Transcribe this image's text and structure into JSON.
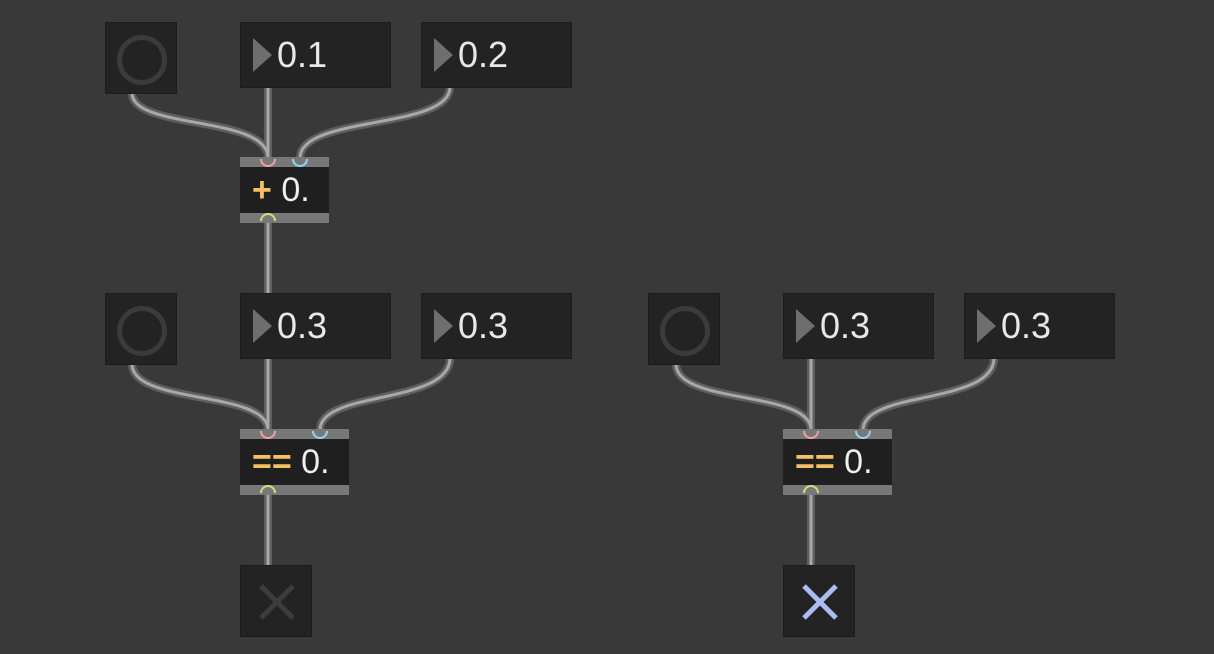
{
  "patch_top": {
    "number_1": "0.1",
    "number_2": "0.2",
    "operator": {
      "symbol": "+",
      "argument": "0."
    }
  },
  "patch_left": {
    "number_1": "0.3",
    "number_2": "0.3",
    "operator": {
      "symbol": "==",
      "argument": "0."
    },
    "toggle_state": "off"
  },
  "patch_right": {
    "number_1": "0.3",
    "number_2": "0.3",
    "operator": {
      "symbol": "==",
      "argument": "0."
    },
    "toggle_state": "on"
  },
  "colors": {
    "background": "#393939",
    "operator_symbol": "#f5c061",
    "inlet_left": "#f2a0a0",
    "inlet_right": "#8dd8f0",
    "outlet": "#cfe07a",
    "toggle_on": "#a9bdf2",
    "toggle_off": "#3c3c3c"
  },
  "icons": {
    "bang": "circle-ring-icon",
    "number_arrow": "triangle-right-icon",
    "toggle": "x-cross-icon"
  }
}
